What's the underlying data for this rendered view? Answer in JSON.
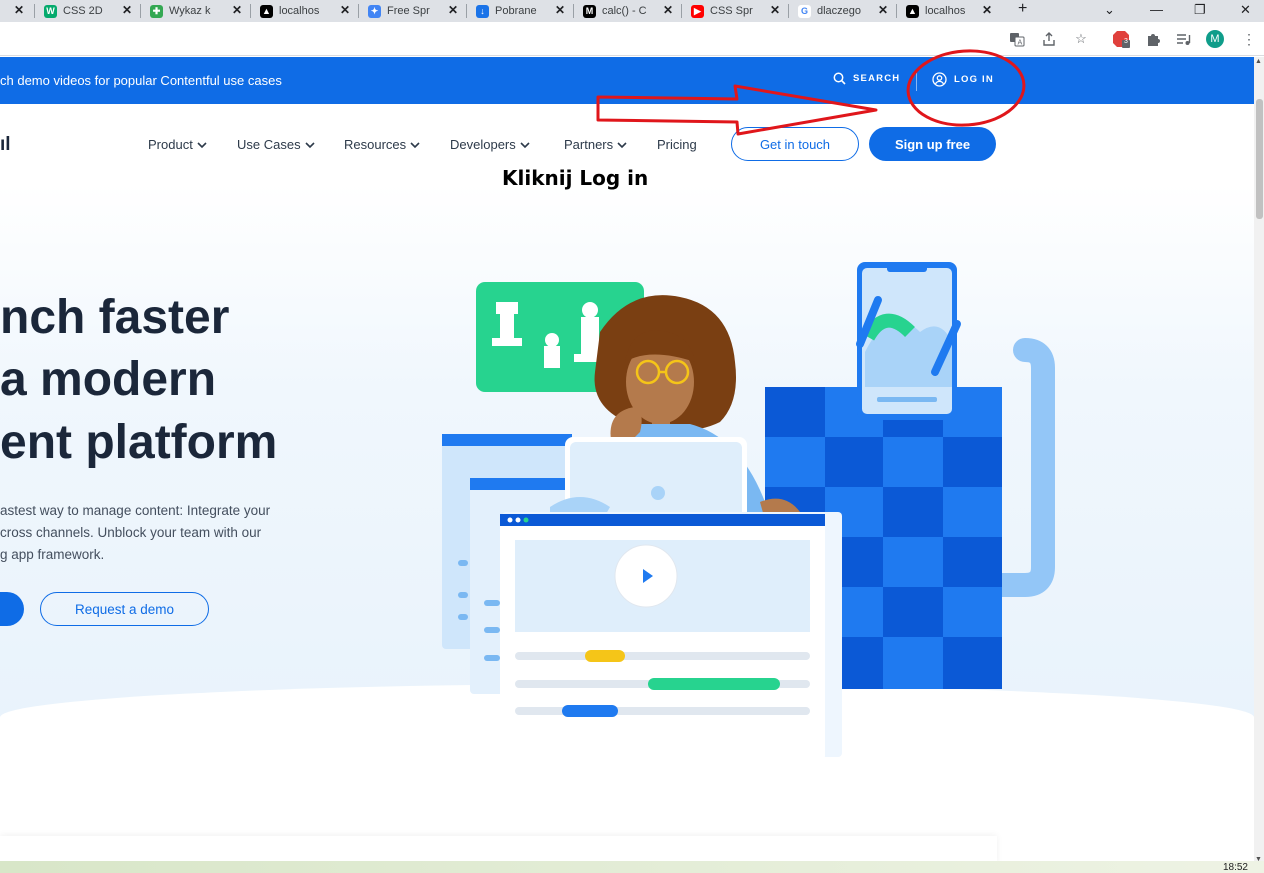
{
  "browser": {
    "tabs": [
      {
        "title": "",
        "icon": "partial-tab-icon",
        "color": "#dee1e6",
        "glyph": ""
      },
      {
        "title": "CSS 2D",
        "icon": "w3-icon",
        "color": "#04aa6d",
        "glyph": "W"
      },
      {
        "title": "Wykaz k",
        "icon": "puzzle-color-icon",
        "color": "#34a853",
        "glyph": "✚"
      },
      {
        "title": "localhos",
        "icon": "vercel-icon",
        "color": "#000000",
        "glyph": "▲"
      },
      {
        "title": "Free Spr",
        "icon": "globe-icon",
        "color": "#4285f4",
        "glyph": "✦"
      },
      {
        "title": "Pobrane",
        "icon": "download-icon",
        "color": "#1a73e8",
        "glyph": "↓"
      },
      {
        "title": "calc() - C",
        "icon": "mdn-icon",
        "color": "#000000",
        "glyph": "M"
      },
      {
        "title": "CSS Spr",
        "icon": "youtube-icon",
        "color": "#ff0000",
        "glyph": "▶"
      },
      {
        "title": "dlaczego",
        "icon": "google-icon",
        "color": "#ffffff",
        "glyph": "G"
      },
      {
        "title": "localhos",
        "icon": "vercel-icon",
        "color": "#000000",
        "glyph": "▲"
      }
    ],
    "new_tab": "+",
    "profile_initial": "M",
    "extension_badge": "3"
  },
  "announcement": {
    "text": "ch demo videos for popular Contentful use cases",
    "search_label": "SEARCH",
    "login_label": "LOG IN"
  },
  "nav": {
    "logo_fragment": "ıl",
    "items": [
      "Product",
      "Use Cases",
      "Resources",
      "Developers",
      "Partners",
      "Pricing"
    ],
    "get_in_touch": "Get in touch",
    "sign_up": "Sign up free"
  },
  "hero": {
    "headline": [
      "nch faster",
      " a modern",
      "ent platform"
    ],
    "body": [
      "astest way to manage content: Integrate your",
      "cross channels. Unblock your team with our",
      "g app framework."
    ],
    "request_demo": "Request a demo"
  },
  "annotation": {
    "text": "Kliknij Log in",
    "color": "#e0161b"
  },
  "taskbar": {
    "clock": "18:52"
  },
  "colors": {
    "brand_blue": "#0f6ce6",
    "annotation_red": "#e0161b",
    "green_card": "#27d38f"
  }
}
